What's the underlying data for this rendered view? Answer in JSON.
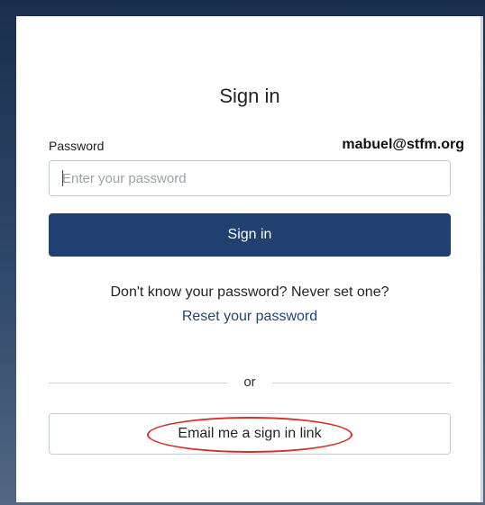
{
  "login": {
    "title": "Sign in",
    "password_label": "Password",
    "account_email": "mabuel@stfm.org",
    "password_placeholder": "Enter your password",
    "signin_button_label": "Sign in",
    "help_text": "Don't know your password? Never set one?",
    "reset_link_label": "Reset your password",
    "divider_text": "or",
    "email_link_button_label": "Email me a sign in link"
  },
  "colors": {
    "primary_button": "#20406f",
    "link": "#1e4677",
    "highlight_annotation": "#d1332c"
  }
}
